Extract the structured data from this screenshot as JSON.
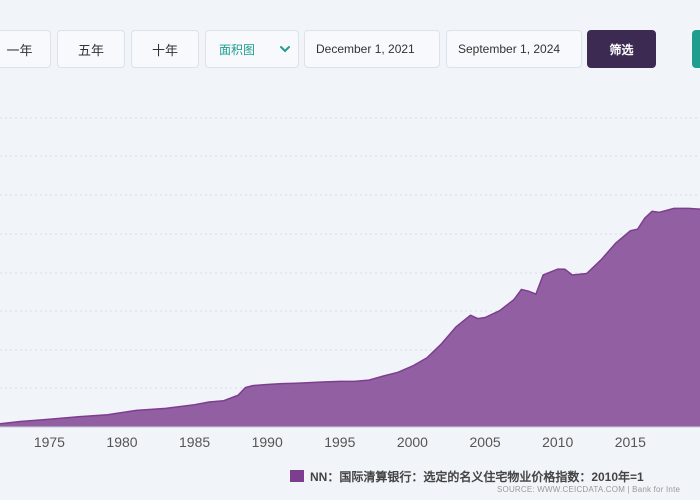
{
  "toolbar": {
    "btn_1y": "一年",
    "btn_5y": "五年",
    "btn_10y": "十年",
    "chart_type_select": "面积图",
    "date_start": "December 1, 2021",
    "date_end": "September 1, 2024",
    "filter_label": "筛选"
  },
  "colors": {
    "series_fill": "#935fa3",
    "series_line": "#7d3e8f",
    "accent_dark": "#3c2a52",
    "accent_teal": "#1f9d8f"
  },
  "chart_data": {
    "type": "area",
    "x_tick_labels": [
      "1975",
      "1980",
      "1985",
      "1990",
      "1995",
      "2000",
      "2005",
      "2010",
      "2015"
    ],
    "xlim": [
      1971.6,
      2019.8
    ],
    "ylim": [
      0,
      100
    ],
    "grid": true,
    "legend_position": "bottom",
    "series": [
      {
        "name": "NN：国际清算银行：选定的名义住宅物业价格指数：2010年=1",
        "x": [
          1971.6,
          1973,
          1975,
          1977,
          1979,
          1981,
          1983,
          1985,
          1986,
          1987,
          1988,
          1988.5,
          1989,
          1990,
          1991,
          1992,
          1994,
          1995,
          1996,
          1997,
          1998,
          1999,
          2000,
          2001,
          2002,
          2003,
          2004,
          2004.5,
          2005,
          2006,
          2007,
          2007.5,
          2008,
          2008.5,
          2009,
          2010,
          2010.5,
          2011,
          2012,
          2013,
          2014,
          2015,
          2015.5,
          2016,
          2016.5,
          2017,
          2018,
          2019,
          2019.8
        ],
        "values": [
          1.5,
          2.5,
          3.5,
          4.7,
          5.6,
          7.6,
          8.5,
          10.2,
          11.4,
          12.0,
          14.5,
          18.0,
          18.9,
          19.4,
          19.8,
          20.0,
          20.6,
          20.8,
          20.8,
          21.4,
          23.3,
          25.0,
          27.8,
          31.6,
          38.0,
          45.7,
          51.0,
          49.5,
          50.0,
          53.1,
          58.2,
          62.8,
          62.0,
          60.7,
          69.4,
          72.1,
          72.0,
          69.4,
          70.1,
          76.4,
          84.0,
          89.6,
          90.3,
          95.4,
          98.5,
          98.0,
          99.8,
          99.8,
          99.5
        ]
      }
    ]
  },
  "source_text": "SOURCE: WWW.CEICDATA.COM | Bank for Inte"
}
